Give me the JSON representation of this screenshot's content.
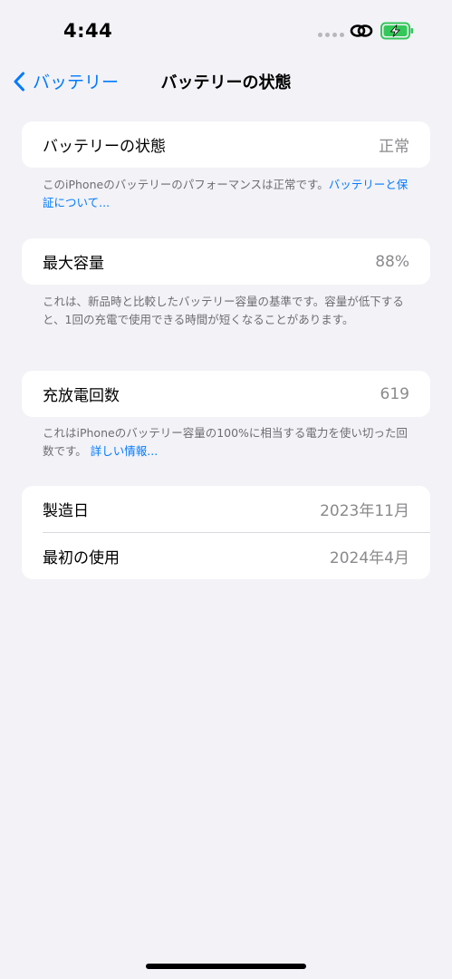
{
  "status_bar": {
    "time": "4:44"
  },
  "nav": {
    "back_label": "バッテリー",
    "title": "バッテリーの状態"
  },
  "battery_health": {
    "label": "バッテリーの状態",
    "value": "正常",
    "footnote_text": "このiPhoneのバッテリーのパフォーマンスは正常です。",
    "footnote_link": "バッテリーと保証について..."
  },
  "max_capacity": {
    "label": "最大容量",
    "value": "88%",
    "footnote_text": "これは、新品時と比較したバッテリー容量の基準です。容量が低下すると、1回の充電で使用できる時間が短くなることがあります。"
  },
  "cycle_count": {
    "label": "充放電回数",
    "value": "619",
    "footnote_text": "これはiPhoneのバッテリー容量の100%に相当する電力を使い切った回数です。",
    "footnote_link": "詳しい情報..."
  },
  "dates": {
    "manufacture_label": "製造日",
    "manufacture_value": "2023年11月",
    "first_use_label": "最初の使用",
    "first_use_value": "2024年4月"
  },
  "colors": {
    "accent": "#007aff",
    "battery_green": "#34c759",
    "background": "#f2f2f7"
  }
}
